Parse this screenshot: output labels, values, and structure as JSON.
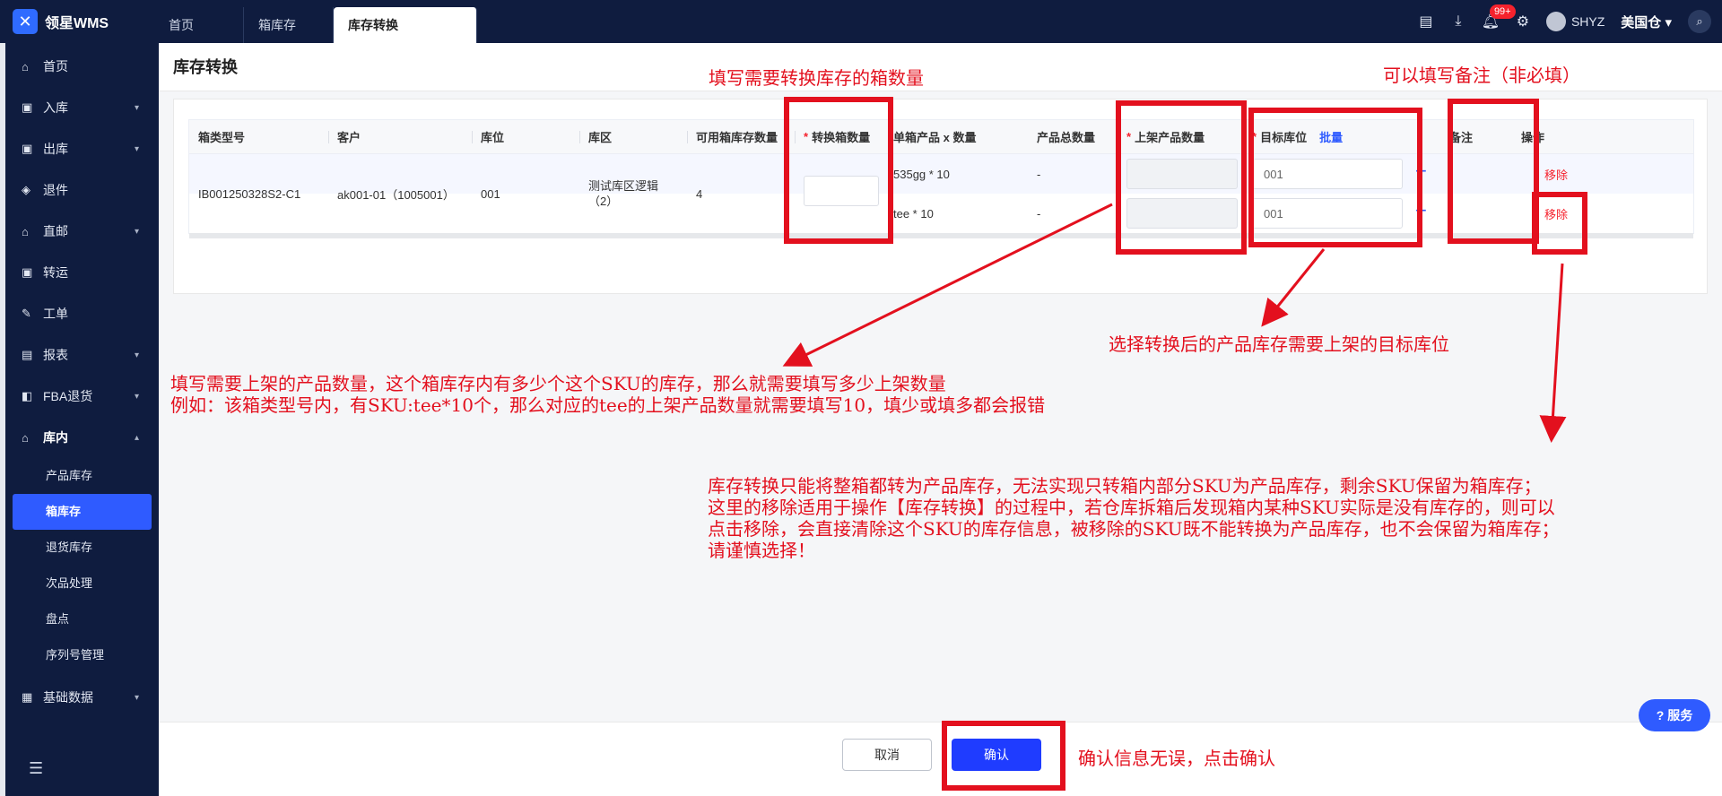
{
  "app": {
    "name": "领星WMS"
  },
  "tabs": [
    {
      "label": "首页"
    },
    {
      "label": "箱库存"
    },
    {
      "label": "库存转换"
    }
  ],
  "header": {
    "notify_count": "99+",
    "user": "SHYZ",
    "warehouse": "美国仓"
  },
  "sidebar": {
    "items": [
      {
        "label": "首页"
      },
      {
        "label": "入库"
      },
      {
        "label": "出库"
      },
      {
        "label": "退件"
      },
      {
        "label": "直邮"
      },
      {
        "label": "转运"
      },
      {
        "label": "工单"
      },
      {
        "label": "报表"
      },
      {
        "label": "FBA退货"
      },
      {
        "label": "库内"
      }
    ],
    "sub_items": [
      {
        "label": "产品库存"
      },
      {
        "label": "箱库存"
      },
      {
        "label": "退货库存"
      },
      {
        "label": "次品处理"
      },
      {
        "label": "盘点"
      },
      {
        "label": "序列号管理"
      }
    ],
    "last_item": {
      "label": "基础数据"
    }
  },
  "page": {
    "title": "库存转换"
  },
  "table": {
    "columns": [
      "箱类型号",
      "客户",
      "库位",
      "库区",
      "可用箱库存数量",
      "转换箱数量",
      "单箱产品 x 数量",
      "产品总数量",
      "上架产品数量",
      "目标库位",
      "备注",
      "操作"
    ],
    "batch_label": "批量",
    "row": {
      "box_type": "IB001250328S2-C1",
      "customer": "ak001-01（1005001）",
      "location": "001",
      "zone": "测试库区逻辑",
      "zone_sub": "（2）",
      "available": "4",
      "convert_qty": ""
    },
    "products": [
      {
        "item": "535gg * 10",
        "total": "-",
        "target": "001",
        "action": "移除"
      },
      {
        "item": "tee * 10",
        "total": "-",
        "target": "001",
        "action": "移除"
      }
    ]
  },
  "footer": {
    "cancel_label": "取消",
    "confirm_label": "确认"
  },
  "service_label": "服务",
  "annotations": {
    "a1": "填写需要转换库存的箱数量",
    "a2": "可以填写备注（非必填）",
    "a3": "选择转换后的产品库存需要上架的目标库位",
    "a4_line1": "填写需要上架的产品数量，这个箱库存内有多少个这个SKU的库存，那么就需要填写多少上架数量",
    "a4_line2": "例如：该箱类型号内，有SKU:tee*10个，那么对应的tee的上架产品数量就需要填写10，填少或填多都会报错",
    "a5_line1": "库存转换只能将整箱都转为产品库存，无法实现只转箱内部分SKU为产品库存，剩余SKU保留为箱库存；",
    "a5_line2": "这里的移除适用于操作【库存转换】的过程中，若仓库拆箱后发现箱内某种SKU实际是没有库存的，则可以",
    "a5_line3": "点击移除，会直接清除这个SKU的库存信息，被移除的SKU既不能转换为产品库存，也不会保留为箱库存；",
    "a5_line4": "请谨慎选择！",
    "a6": "确认信息无误，点击确认"
  },
  "colors": {
    "accent": "#2f5bff",
    "annotation": "#e3101e",
    "topbar": "#0f1c3f"
  }
}
